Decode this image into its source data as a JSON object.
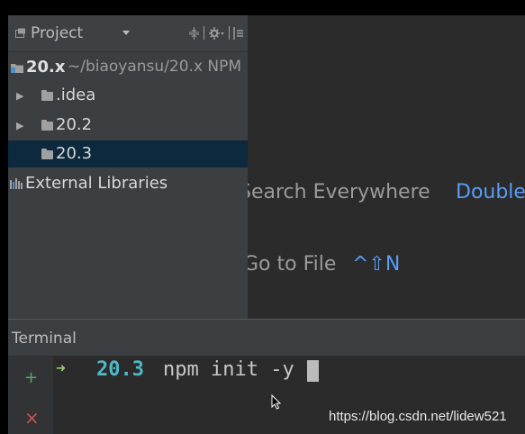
{
  "colors": {
    "panel_bg": "#3c3f41",
    "editor_bg": "#2b2b2b",
    "selection": "#0d293e",
    "accent_blue": "#589df6",
    "prompt_green": "#98c379",
    "dir_cyan": "#4fb8c6",
    "add_green": "#59a869",
    "close_red": "#c75450"
  },
  "project_panel": {
    "title": "Project",
    "title_icon": "project-view-icon",
    "dropdown_icon": "chevron-down-icon",
    "toolbar_icons": [
      "collapse-icon",
      "gear-icon",
      "hide-icon"
    ],
    "root": {
      "name": "20.x",
      "path": "~/biaoyansu/20.x NPM"
    },
    "items": [
      {
        "label": ".idea",
        "icon": "folder-icon",
        "expandable": true
      },
      {
        "label": "20.2",
        "icon": "folder-icon",
        "expandable": true
      },
      {
        "label": "20.3",
        "icon": "folder-icon",
        "expandable": false,
        "selected": true
      }
    ],
    "external": {
      "label": "External Libraries",
      "icon": "libraries-icon"
    }
  },
  "editor": {
    "hints": [
      {
        "label": "Search Everywhere",
        "shortcut": "Double"
      },
      {
        "label": "Go to File",
        "shortcut": "^⇧N"
      }
    ]
  },
  "terminal": {
    "title": "Terminal",
    "prompt_symbol": "➜",
    "directory": "20.3",
    "command": "npm init -y",
    "add_icon": "+",
    "close_icon": "×"
  },
  "watermark": "https://blog.csdn.net/lidew521"
}
